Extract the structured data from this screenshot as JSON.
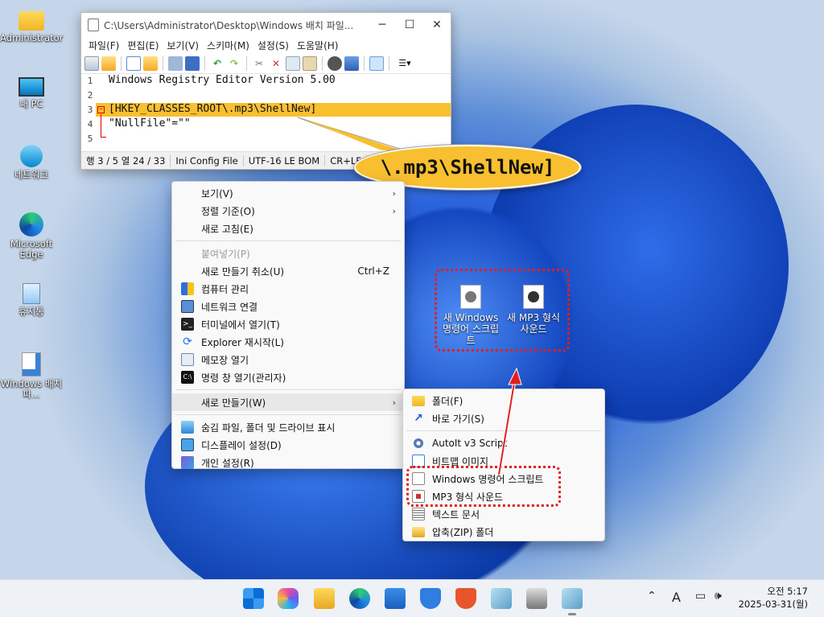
{
  "desktop_icons": [
    {
      "label": "Administrator",
      "icon": "folder-icon"
    },
    {
      "label": "내 PC",
      "icon": "pc-icon"
    },
    {
      "label": "네트워크",
      "icon": "network-icon"
    },
    {
      "label": "Microsoft Edge",
      "icon": "edge-icon"
    },
    {
      "label": "휴지통",
      "icon": "recycle-bin-icon"
    },
    {
      "label": "Windows 배치 파...",
      "icon": "batch-file-icon"
    }
  ],
  "notepad": {
    "title": "C:\\Users\\Administrator\\Desktop\\Windows 배치 파일...",
    "menu": [
      "파일(F)",
      "편집(E)",
      "보기(V)",
      "스키마(M)",
      "설정(S)",
      "도움말(H)"
    ],
    "lines": [
      {
        "num": "1",
        "text": "Windows Registry Editor Version 5.00"
      },
      {
        "num": "2",
        "text": ""
      },
      {
        "num": "3",
        "text": "[HKEY_CLASSES_ROOT\\.mp3\\ShellNew]"
      },
      {
        "num": "4",
        "text": "\"NullFile\"=\"\""
      },
      {
        "num": "5",
        "text": ""
      }
    ],
    "status": {
      "position": "행 3 / 5  열 24 / 33",
      "syntax": "Ini Config File",
      "encoding": "UTF-16 LE BOM",
      "eol": "CR+LF"
    }
  },
  "callout": {
    "text": "\\.mp3\\ShellNew]",
    "color": "#f8c030"
  },
  "context_menu": {
    "items": [
      {
        "label": "보기(V)",
        "submenu": true
      },
      {
        "label": "정렬 기준(O)",
        "submenu": true
      },
      {
        "label": "새로 고침(E)"
      },
      {
        "label": "붙여넣기(P)",
        "disabled": true
      },
      {
        "label": "새로 만들기 취소(U)",
        "shortcut": "Ctrl+Z"
      },
      {
        "label": "컴퓨터 관리",
        "icon": "shield-icon"
      },
      {
        "label": "네트워크 연결",
        "icon": "network-icon"
      },
      {
        "label": "터미널에서 열기(T)",
        "icon": "terminal-icon"
      },
      {
        "label": "Explorer 재시작(L)",
        "icon": "refresh-icon"
      },
      {
        "label": "메모장 열기",
        "icon": "notepad-icon"
      },
      {
        "label": "명령 창 열기(관리자)",
        "icon": "cmd-icon"
      },
      {
        "label": "새로 만들기(W)",
        "submenu": true
      },
      {
        "label": "숨김 파일, 폴더 및 드라이브 표시",
        "icon": "hidden-files-icon"
      },
      {
        "label": "디스플레이 설정(D)",
        "icon": "display-icon"
      },
      {
        "label": "개인 설정(R)",
        "icon": "personalize-icon"
      }
    ]
  },
  "new_submenu": {
    "items": [
      {
        "label": "폴더(F)",
        "icon": "folder-icon"
      },
      {
        "label": "바로 가기(S)",
        "icon": "shortcut-icon"
      },
      {
        "label": "AutoIt v3 Script",
        "icon": "autoit-icon"
      },
      {
        "label": "비트맵 이미지",
        "icon": "bitmap-icon"
      },
      {
        "label": "Windows 명령어 스크립트",
        "icon": "cmd-script-icon"
      },
      {
        "label": "MP3 형식 사운드",
        "icon": "mp3-icon"
      },
      {
        "label": "텍스트 문서",
        "icon": "text-doc-icon"
      },
      {
        "label": "압축(ZIP) 폴더",
        "icon": "zip-folder-icon"
      }
    ]
  },
  "new_desktop_icons": [
    {
      "label": "새 Windows 명령어 스크립트",
      "icon": "cmd-script-icon"
    },
    {
      "label": "새 MP3 형식 사운드",
      "icon": "mp3-icon"
    }
  ],
  "taskbar": {
    "apps": [
      "start-icon",
      "copilot-icon",
      "file-explorer-icon",
      "edge-icon",
      "store-icon",
      "defender-icon",
      "security-icon",
      "notepad-icon",
      "printer-icon",
      "notepad-active-icon"
    ],
    "tray": {
      "ime": "A"
    },
    "clock": {
      "time": "오전 5:17",
      "date": "2025-03-31(월)"
    }
  },
  "colors": {
    "highlight": "#f8c030",
    "annotation": "#e02020",
    "accent": "#1a5fd8"
  }
}
